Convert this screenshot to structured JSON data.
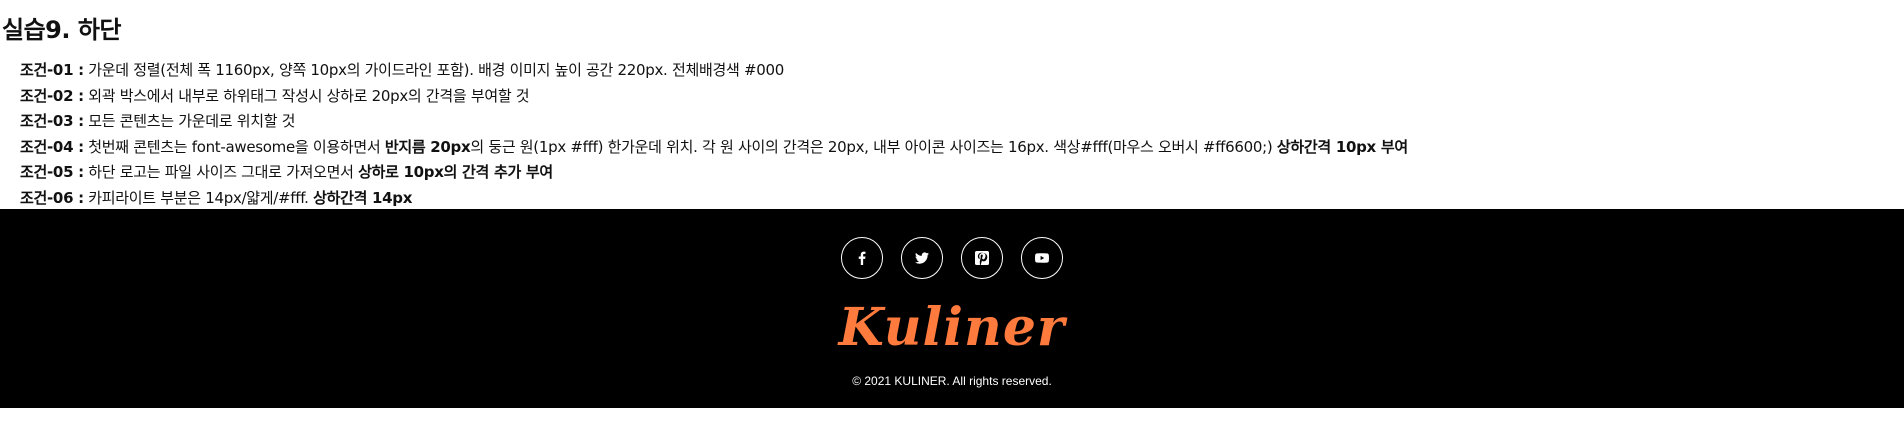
{
  "title": "실습9. 하단",
  "conditions": [
    {
      "label": "조건-01 :",
      "parts": [
        {
          "t": "가운데 정렬(전체 폭 1160px, 양쪽 10px의 가이드라인 포함). 배경 이미지 높이 공간 220px. 전체배경색 #000"
        }
      ]
    },
    {
      "label": "조건-02 :",
      "parts": [
        {
          "t": "외곽 박스에서 내부로 하위태그 작성시 상하로 20px의 간격을 부여할 것"
        }
      ]
    },
    {
      "label": "조건-03 :",
      "parts": [
        {
          "t": "모든 콘텐츠는 가운데로 위치할 것"
        }
      ]
    },
    {
      "label": "조건-04 :",
      "parts": [
        {
          "t": "첫번째 콘텐츠는 font-awesome을 이용하면서 "
        },
        {
          "t": "반지름 20px",
          "b": true
        },
        {
          "t": "의 둥근 원(1px #fff) 한가운데 위치. 각 원 사이의 간격은 20px, 내부 아이콘 사이즈는 16px. 색상#fff(마우스 오버시 #ff6600;) "
        },
        {
          "t": "상하간격 10px 부여",
          "b": true
        }
      ]
    },
    {
      "label": "조건-05 :",
      "parts": [
        {
          "t": "하단 로고는 파일 사이즈 그대로 가져오면서 "
        },
        {
          "t": "상하로 10px의 간격 추가 부여",
          "b": true
        }
      ]
    },
    {
      "label": "조건-06 :",
      "parts": [
        {
          "t": "카피라이트 부분은 14px/얇게/#fff. "
        },
        {
          "t": "상하간격 14px",
          "b": true
        }
      ]
    }
  ],
  "footer": {
    "background": "#000000",
    "sns": [
      {
        "name": "facebook-icon"
      },
      {
        "name": "twitter-icon"
      },
      {
        "name": "pinterest-icon"
      },
      {
        "name": "youtube-icon"
      }
    ],
    "logo_text": "Kuliner",
    "logo_color": "#ff7a3d",
    "copyright": "© 2021 KULINER. All rights reserved."
  }
}
